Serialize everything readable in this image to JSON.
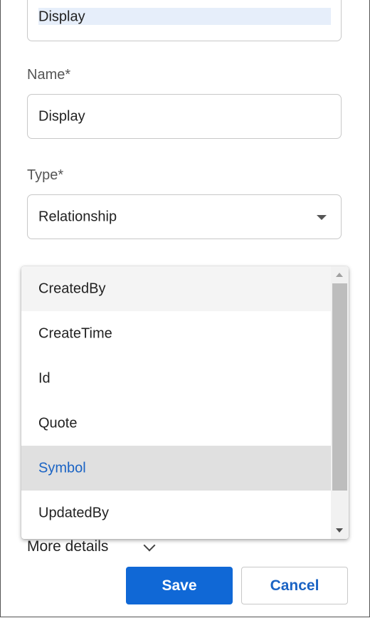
{
  "top_field": {
    "value": "Display"
  },
  "name_field": {
    "label": "Name*",
    "value": "Display"
  },
  "type_field": {
    "label": "Type*",
    "value": "Relationship"
  },
  "dropdown": {
    "options": [
      "CreatedBy",
      "CreateTime",
      "Id",
      "Quote",
      "Symbol",
      "UpdatedBy"
    ],
    "hovered": "CreatedBy",
    "selected": "Symbol"
  },
  "more_details": {
    "label": "More details"
  },
  "buttons": {
    "save": "Save",
    "cancel": "Cancel"
  },
  "colors": {
    "primary": "#1068d6",
    "selected_text": "#1a63c4"
  }
}
